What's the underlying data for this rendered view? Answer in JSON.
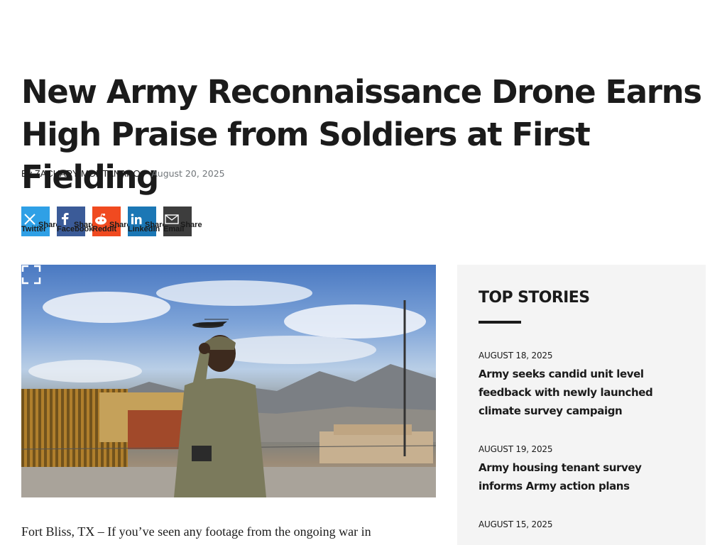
{
  "article": {
    "headline": "New Army Reconnaissance Drone Earns High Praise from Soldiers at First Fielding",
    "byline_prefix": "By",
    "author": "ZACHARY MONTANARO",
    "date": "August 20, 2025",
    "body_start": "Fort Bliss, TX – If you’ve seen any footage from the ongoing war in"
  },
  "share": [
    {
      "network": "Twitter",
      "label": "Share",
      "icon": "x-twitter-icon",
      "color": "#2fa0e6"
    },
    {
      "network": "Facebook",
      "label": "Share",
      "icon": "facebook-icon",
      "color": "#3b5b98"
    },
    {
      "network": "Reddit",
      "label": "Share",
      "icon": "reddit-icon",
      "color": "#f04a20"
    },
    {
      "network": "LinkedIn",
      "label": "Share",
      "icon": "linkedin-icon",
      "color": "#1b77b5"
    },
    {
      "network": "Email",
      "label": "Share",
      "icon": "email-icon",
      "color": "#3d3d3d"
    }
  ],
  "hero_image": {
    "expand_icon": "expand-icon"
  },
  "sidebar": {
    "title": "TOP STORIES",
    "stories": [
      {
        "date": "AUGUST 18, 2025",
        "title": "Army seeks candid unit level feedback with newly launched climate survey campaign"
      },
      {
        "date": "AUGUST 19, 2025",
        "title": "Army housing tenant survey informs Army action plans"
      },
      {
        "date": "AUGUST 15, 2025",
        "title": ""
      }
    ]
  }
}
